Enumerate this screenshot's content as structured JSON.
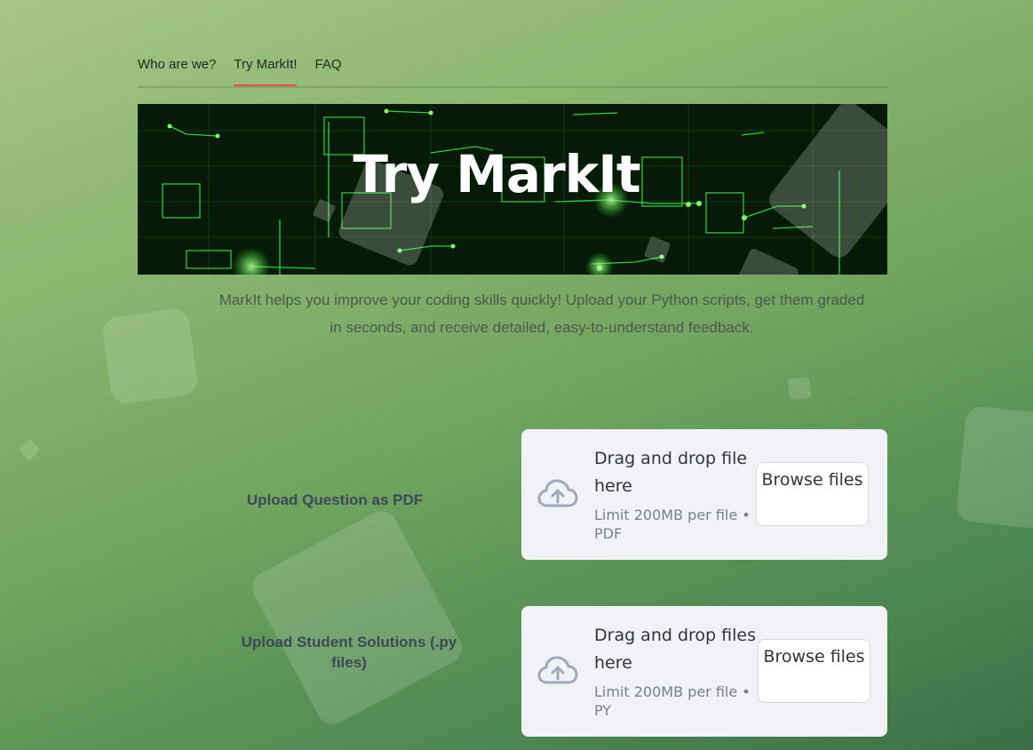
{
  "tabs": [
    {
      "label": "Who are we?"
    },
    {
      "label": "Try MarkIt!"
    },
    {
      "label": "FAQ"
    }
  ],
  "banner": {
    "title": "Try MarkIt"
  },
  "intro": "MarkIt helps you improve your coding skills quickly! Upload your Python scripts, get them graded in seconds, and receive detailed, easy-to-understand feedback.",
  "uploaders": [
    {
      "label": "Upload Question as PDF",
      "drop_text": "Drag and drop file here",
      "limit_text": "Limit 200MB per file • PDF",
      "button": "Browse files"
    },
    {
      "label": "Upload Student Solutions (.py files)",
      "drop_text": "Drag and drop files here",
      "limit_text": "Limit 200MB per file • PY",
      "button": "Browse files"
    }
  ],
  "colors": {
    "active_tab_underline": "#ff4b4b",
    "dropzone_bg": "#f0f2f6",
    "icon": "#a3a8b8"
  }
}
